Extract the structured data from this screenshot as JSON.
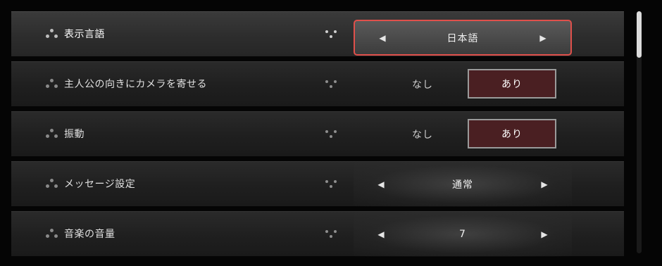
{
  "settings": [
    {
      "label": "表示言語",
      "type": "selector",
      "value": "日本語",
      "selected": true
    },
    {
      "label": "主人公の向きにカメラを寄せる",
      "type": "toggle",
      "options": [
        "なし",
        "あり"
      ],
      "value": "あり"
    },
    {
      "label": "振動",
      "type": "toggle",
      "options": [
        "なし",
        "あり"
      ],
      "value": "あり"
    },
    {
      "label": "メッセージ設定",
      "type": "selector",
      "value": "通常"
    },
    {
      "label": "音楽の音量",
      "type": "selector",
      "value": "7"
    }
  ],
  "arrows": {
    "left": "◀",
    "right": "▶"
  },
  "colors": {
    "focus_border": "#e0504b",
    "toggle_active_bg": "#4a1f22"
  },
  "scrollbar": {
    "position": 0
  }
}
